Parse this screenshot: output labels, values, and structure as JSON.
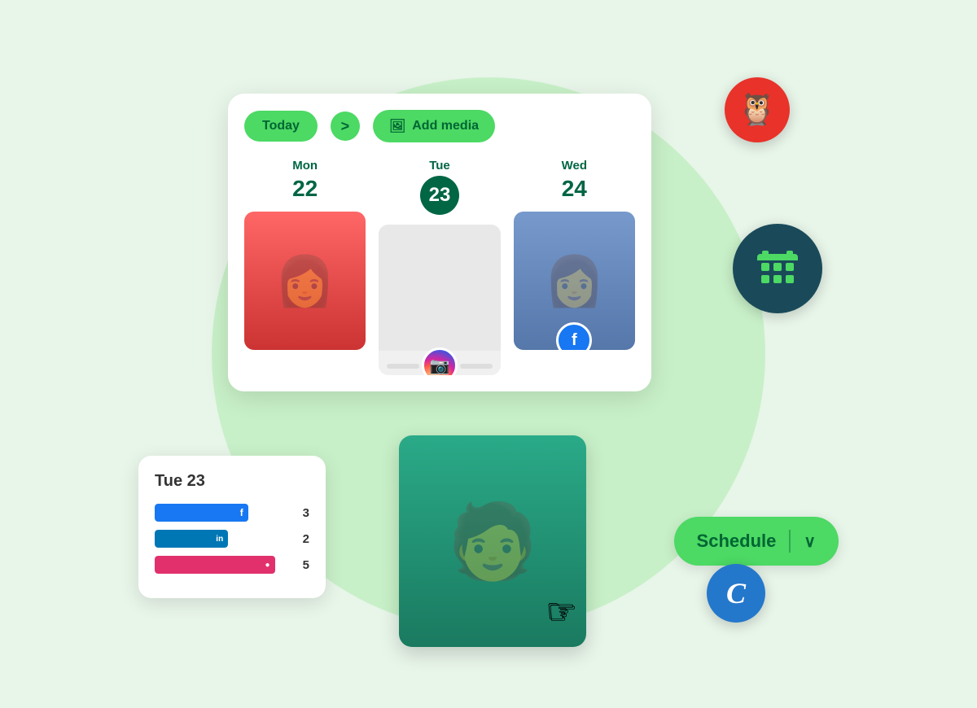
{
  "scene": {
    "background_color": "#e8f5e9",
    "bg_circle_color": "#c8f0c8"
  },
  "toolbar": {
    "today_label": "Today",
    "arrow_label": ">",
    "add_media_label": "Add media"
  },
  "calendar": {
    "days": [
      {
        "day_name": "Mon",
        "day_number": "22",
        "active": false
      },
      {
        "day_name": "Tue",
        "day_number": "23",
        "active": true
      },
      {
        "day_name": "Wed",
        "day_number": "24",
        "active": false
      }
    ]
  },
  "stats_card": {
    "date_label": "Tue 23",
    "rows": [
      {
        "platform": "facebook",
        "color": "#1877f2",
        "bar_width": "70%",
        "count": "3",
        "icon": "f"
      },
      {
        "platform": "linkedin",
        "color": "#0077b5",
        "bar_width": "55%",
        "count": "2",
        "icon": "in"
      },
      {
        "platform": "instagram",
        "color": "#e1306c",
        "bar_width": "90%",
        "count": "5",
        "icon": "IG"
      }
    ]
  },
  "schedule_button": {
    "label": "Schedule",
    "divider": "|",
    "chevron": "∨"
  },
  "badges": {
    "hootsuite": "🦉",
    "calendar": "calendar",
    "contentful_letter": "C"
  }
}
